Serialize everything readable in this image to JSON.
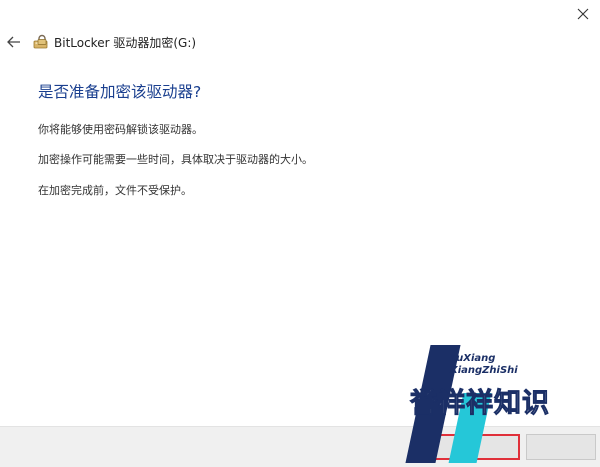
{
  "window": {
    "title": "BitLocker 驱动器加密(G:)",
    "close_icon": "close-icon",
    "back_icon": "back-arrow-icon",
    "drive_icon": "bitlocker-drive-icon"
  },
  "main": {
    "heading": "是否准备加密该驱动器?",
    "paragraphs": [
      "你将能够使用密码解锁该驱动器。",
      "加密操作可能需要一些时间，具体取决于驱动器的大小。",
      "在加密完成前，文件不受保护。"
    ]
  },
  "footer": {
    "start_button_label": "",
    "cancel_button_label": ""
  },
  "watermark": {
    "line1": "YuXiang",
    "line2": "XiangZhiShi",
    "big": "誉祥祥知识"
  },
  "colors": {
    "heading": "#1a3f8f",
    "highlight_border": "#e0303a",
    "watermark_blue": "#1b2f66",
    "watermark_cyan": "#25c7d8"
  }
}
